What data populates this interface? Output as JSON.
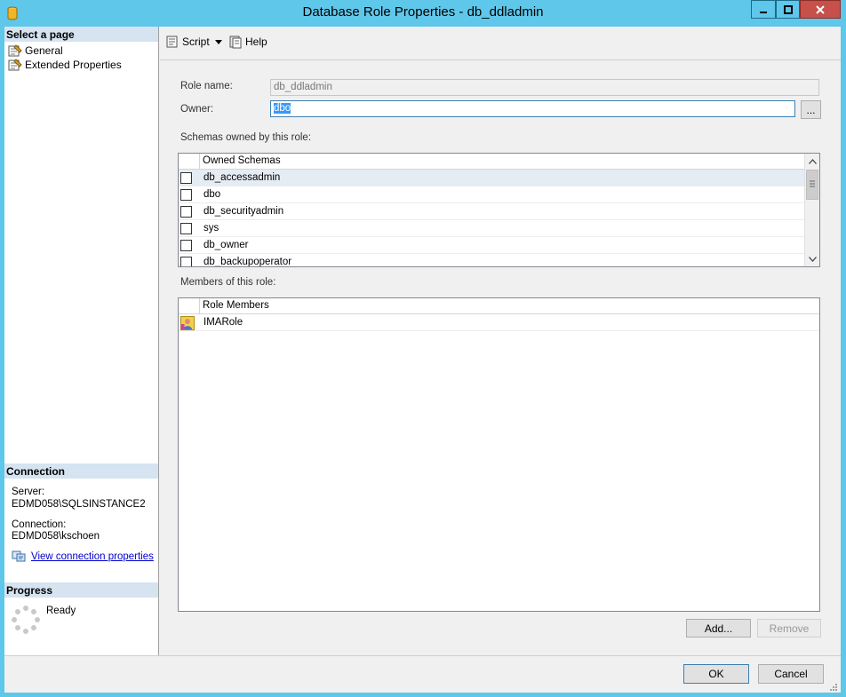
{
  "window": {
    "title": "Database Role Properties - db_ddladmin"
  },
  "left_pane": {
    "select_page_header": "Select a page",
    "pages": [
      {
        "label": "General"
      },
      {
        "label": "Extended Properties"
      }
    ],
    "connection_header": "Connection",
    "server_label": "Server:",
    "server_value": "EDMD058\\SQLSINSTANCE2",
    "connection_label": "Connection:",
    "connection_value": "EDMD058\\kschoen",
    "view_connection_link": "View connection properties",
    "progress_header": "Progress",
    "progress_status": "Ready"
  },
  "toolbar": {
    "script_label": "Script",
    "help_label": "Help"
  },
  "form": {
    "role_name_label": "Role name:",
    "role_name_value": "db_ddladmin",
    "owner_label": "Owner:",
    "owner_value": "dbo",
    "browse_label": "...",
    "schemas_label": "Schemas owned by this role:",
    "schemas_header": "Owned Schemas",
    "schemas": [
      {
        "name": "db_accessadmin",
        "checked": false
      },
      {
        "name": "dbo",
        "checked": false
      },
      {
        "name": "db_securityadmin",
        "checked": false
      },
      {
        "name": "sys",
        "checked": false
      },
      {
        "name": "db_owner",
        "checked": false
      },
      {
        "name": "db_backupoperator",
        "checked": false
      }
    ],
    "members_label": "Members of this role:",
    "members_header": "Role Members",
    "members": [
      {
        "name": "IMARole"
      }
    ],
    "add_label": "Add...",
    "remove_label": "Remove"
  },
  "footer": {
    "ok_label": "OK",
    "cancel_label": "Cancel"
  }
}
